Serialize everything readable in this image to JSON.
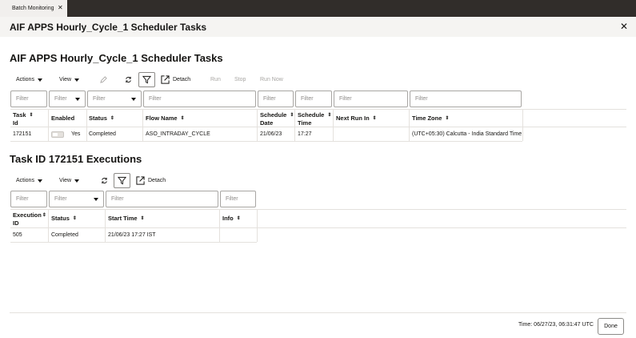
{
  "tab": {
    "label": "Batch Monitoring",
    "close": "✕"
  },
  "dialog": {
    "title": "AIF APPS Hourly_Cycle_1 Scheduler Tasks",
    "close": "✕"
  },
  "tasks": {
    "title": "AIF APPS Hourly_Cycle_1 Scheduler Tasks",
    "toolbar": {
      "actions": "Actions",
      "view": "View",
      "detach": "Detach",
      "run": "Run",
      "stop": "Stop",
      "run_now": "Run Now"
    },
    "filters": [
      "Filter",
      "Filter",
      "Filter",
      "Filter",
      "Filter",
      "Filter",
      "Filter",
      "Filter"
    ],
    "columns": {
      "task_id": [
        "Task",
        "Id"
      ],
      "enabled": "Enabled",
      "status": "Status",
      "flow_name": "Flow Name",
      "schedule_date": [
        "Schedule",
        "Date"
      ],
      "schedule_time": [
        "Schedule",
        "Time"
      ],
      "next_run_in": "Next Run In",
      "time_zone": "Time Zone"
    },
    "rows": [
      {
        "task_id": "172151",
        "enabled": "Yes",
        "status": "Completed",
        "flow_name": "ASO_INTRADAY_CYCLE",
        "schedule_date": "21/06/23",
        "schedule_time": "17:27",
        "next_run_in": "",
        "time_zone": "(UTC+05:30) Calcutta - India Standard Time"
      }
    ]
  },
  "executions": {
    "title": "Task ID 172151 Executions",
    "toolbar": {
      "actions": "Actions",
      "view": "View",
      "detach": "Detach"
    },
    "filters": [
      "Filter",
      "Filter",
      "Filter",
      "Filter"
    ],
    "columns": {
      "execution_id": [
        "Execution",
        "ID"
      ],
      "status": "Status",
      "start_time": "Start Time",
      "info": "Info"
    },
    "rows": [
      {
        "execution_id": "505",
        "status": "Completed",
        "start_time": "21/06/23 17:27 IST",
        "info": ""
      }
    ]
  },
  "footer": {
    "time": "Time:  06/27/23, 06:31:47 UTC",
    "done": "Done"
  }
}
